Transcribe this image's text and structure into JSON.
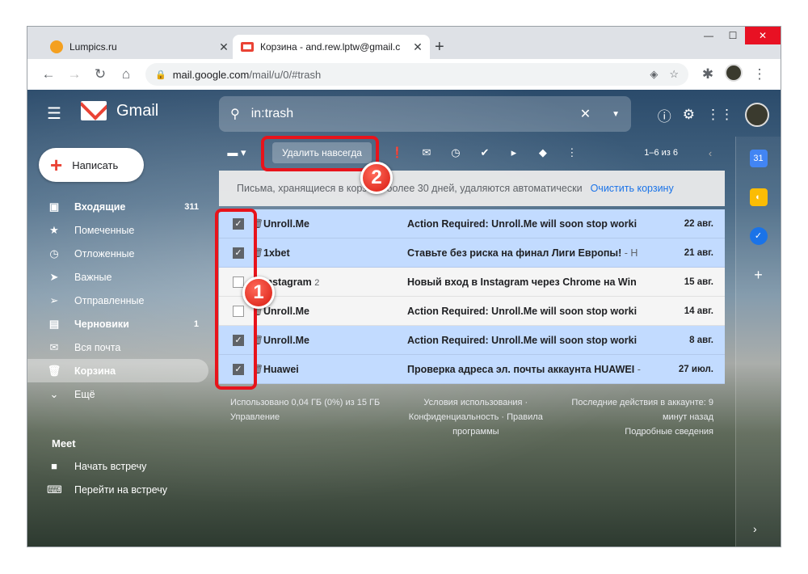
{
  "browser": {
    "tabs": [
      {
        "title": "Lumpics.ru",
        "color": "#f4a020"
      },
      {
        "title": "Корзина - and.rew.lptw@gmail.c",
        "color": "#ea4335"
      }
    ],
    "url_host": "mail.google.com",
    "url_path": "/mail/u/0/#trash"
  },
  "gmail": {
    "logo_text": "Gmail",
    "search_value": "in:trash",
    "compose_label": "Написать",
    "nav": [
      {
        "icon": "inbox-icon",
        "label": "Входящие",
        "count": "311"
      },
      {
        "icon": "star-icon",
        "label": "Помеченные",
        "count": ""
      },
      {
        "icon": "clock-icon",
        "label": "Отложенные",
        "count": ""
      },
      {
        "icon": "label-important-icon",
        "label": "Важные",
        "count": ""
      },
      {
        "icon": "send-icon",
        "label": "Отправленные",
        "count": ""
      },
      {
        "icon": "draft-icon",
        "label": "Черновики",
        "count": "1"
      },
      {
        "icon": "mail-icon",
        "label": "Вся почта",
        "count": ""
      },
      {
        "icon": "trash-icon",
        "label": "Корзина",
        "count": ""
      },
      {
        "icon": "chevron-down-icon",
        "label": "Ещё",
        "count": ""
      }
    ],
    "meet": {
      "title": "Meet",
      "items": [
        "Начать встречу",
        "Перейти на встречу"
      ]
    },
    "toolbar": {
      "delete_forever": "Удалить навсегда",
      "pager": "1–6 из 6"
    },
    "notice": {
      "text": "Письма, хранящиеся в корзине более 30 дней, удаляются автоматически",
      "link": "Очистить корзину"
    },
    "emails": [
      {
        "sender": "Unroll.Me",
        "count": "",
        "subject": "Action Required: Unroll.Me will soon stop worki",
        "snippet": "",
        "date": "22 авг.",
        "checked": true
      },
      {
        "sender": "1xbet",
        "count": "",
        "subject": "Ставьте без риска на финал Лиги Европы!",
        "snippet": " - Н",
        "date": "21 авг.",
        "checked": true
      },
      {
        "sender": "Instagram",
        "count": "2",
        "subject": "Новый вход в Instagram через Chrome на Win",
        "snippet": "",
        "date": "15 авг.",
        "checked": false
      },
      {
        "sender": "Unroll.Me",
        "count": "",
        "subject": "Action Required: Unroll.Me will soon stop worki",
        "snippet": "",
        "date": "14 авг.",
        "checked": false
      },
      {
        "sender": "Unroll.Me",
        "count": "",
        "subject": "Action Required: Unroll.Me will soon stop worki",
        "snippet": "",
        "date": "8 авг.",
        "checked": true
      },
      {
        "sender": "Huawei",
        "count": "",
        "subject": "Проверка адреса эл. почты аккаунта HUAWEI",
        "snippet": " -",
        "date": "27 июл.",
        "checked": true
      }
    ],
    "footer": {
      "left": [
        "Использовано 0,04 ГБ (0%) из 15 ГБ",
        "Управление"
      ],
      "center": [
        "Условия использования ·",
        "Конфиденциальность · Правила",
        "программы"
      ],
      "right": [
        "Последние действия в аккаунте: 9",
        "минут назад",
        "Подробные сведения"
      ]
    }
  },
  "annotations": [
    "1",
    "2"
  ]
}
